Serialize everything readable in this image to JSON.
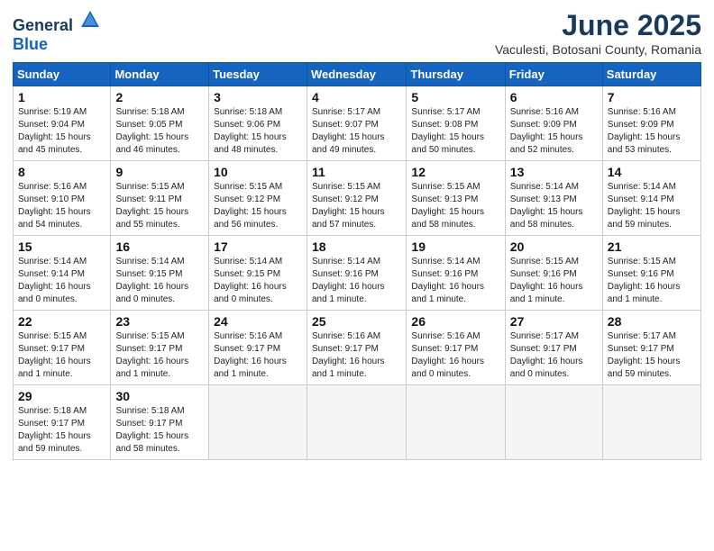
{
  "header": {
    "logo_general": "General",
    "logo_blue": "Blue",
    "month_title": "June 2025",
    "location": "Vaculesti, Botosani County, Romania"
  },
  "columns": [
    "Sunday",
    "Monday",
    "Tuesday",
    "Wednesday",
    "Thursday",
    "Friday",
    "Saturday"
  ],
  "weeks": [
    [
      {
        "day": "1",
        "info": "Sunrise: 5:19 AM\nSunset: 9:04 PM\nDaylight: 15 hours\nand 45 minutes."
      },
      {
        "day": "2",
        "info": "Sunrise: 5:18 AM\nSunset: 9:05 PM\nDaylight: 15 hours\nand 46 minutes."
      },
      {
        "day": "3",
        "info": "Sunrise: 5:18 AM\nSunset: 9:06 PM\nDaylight: 15 hours\nand 48 minutes."
      },
      {
        "day": "4",
        "info": "Sunrise: 5:17 AM\nSunset: 9:07 PM\nDaylight: 15 hours\nand 49 minutes."
      },
      {
        "day": "5",
        "info": "Sunrise: 5:17 AM\nSunset: 9:08 PM\nDaylight: 15 hours\nand 50 minutes."
      },
      {
        "day": "6",
        "info": "Sunrise: 5:16 AM\nSunset: 9:09 PM\nDaylight: 15 hours\nand 52 minutes."
      },
      {
        "day": "7",
        "info": "Sunrise: 5:16 AM\nSunset: 9:09 PM\nDaylight: 15 hours\nand 53 minutes."
      }
    ],
    [
      {
        "day": "8",
        "info": "Sunrise: 5:16 AM\nSunset: 9:10 PM\nDaylight: 15 hours\nand 54 minutes."
      },
      {
        "day": "9",
        "info": "Sunrise: 5:15 AM\nSunset: 9:11 PM\nDaylight: 15 hours\nand 55 minutes."
      },
      {
        "day": "10",
        "info": "Sunrise: 5:15 AM\nSunset: 9:12 PM\nDaylight: 15 hours\nand 56 minutes."
      },
      {
        "day": "11",
        "info": "Sunrise: 5:15 AM\nSunset: 9:12 PM\nDaylight: 15 hours\nand 57 minutes."
      },
      {
        "day": "12",
        "info": "Sunrise: 5:15 AM\nSunset: 9:13 PM\nDaylight: 15 hours\nand 58 minutes."
      },
      {
        "day": "13",
        "info": "Sunrise: 5:14 AM\nSunset: 9:13 PM\nDaylight: 15 hours\nand 58 minutes."
      },
      {
        "day": "14",
        "info": "Sunrise: 5:14 AM\nSunset: 9:14 PM\nDaylight: 15 hours\nand 59 minutes."
      }
    ],
    [
      {
        "day": "15",
        "info": "Sunrise: 5:14 AM\nSunset: 9:14 PM\nDaylight: 16 hours\nand 0 minutes."
      },
      {
        "day": "16",
        "info": "Sunrise: 5:14 AM\nSunset: 9:15 PM\nDaylight: 16 hours\nand 0 minutes."
      },
      {
        "day": "17",
        "info": "Sunrise: 5:14 AM\nSunset: 9:15 PM\nDaylight: 16 hours\nand 0 minutes."
      },
      {
        "day": "18",
        "info": "Sunrise: 5:14 AM\nSunset: 9:16 PM\nDaylight: 16 hours\nand 1 minute."
      },
      {
        "day": "19",
        "info": "Sunrise: 5:14 AM\nSunset: 9:16 PM\nDaylight: 16 hours\nand 1 minute."
      },
      {
        "day": "20",
        "info": "Sunrise: 5:15 AM\nSunset: 9:16 PM\nDaylight: 16 hours\nand 1 minute."
      },
      {
        "day": "21",
        "info": "Sunrise: 5:15 AM\nSunset: 9:16 PM\nDaylight: 16 hours\nand 1 minute."
      }
    ],
    [
      {
        "day": "22",
        "info": "Sunrise: 5:15 AM\nSunset: 9:17 PM\nDaylight: 16 hours\nand 1 minute."
      },
      {
        "day": "23",
        "info": "Sunrise: 5:15 AM\nSunset: 9:17 PM\nDaylight: 16 hours\nand 1 minute."
      },
      {
        "day": "24",
        "info": "Sunrise: 5:16 AM\nSunset: 9:17 PM\nDaylight: 16 hours\nand 1 minute."
      },
      {
        "day": "25",
        "info": "Sunrise: 5:16 AM\nSunset: 9:17 PM\nDaylight: 16 hours\nand 1 minute."
      },
      {
        "day": "26",
        "info": "Sunrise: 5:16 AM\nSunset: 9:17 PM\nDaylight: 16 hours\nand 0 minutes."
      },
      {
        "day": "27",
        "info": "Sunrise: 5:17 AM\nSunset: 9:17 PM\nDaylight: 16 hours\nand 0 minutes."
      },
      {
        "day": "28",
        "info": "Sunrise: 5:17 AM\nSunset: 9:17 PM\nDaylight: 15 hours\nand 59 minutes."
      }
    ],
    [
      {
        "day": "29",
        "info": "Sunrise: 5:18 AM\nSunset: 9:17 PM\nDaylight: 15 hours\nand 59 minutes."
      },
      {
        "day": "30",
        "info": "Sunrise: 5:18 AM\nSunset: 9:17 PM\nDaylight: 15 hours\nand 58 minutes."
      },
      {
        "day": "",
        "info": ""
      },
      {
        "day": "",
        "info": ""
      },
      {
        "day": "",
        "info": ""
      },
      {
        "day": "",
        "info": ""
      },
      {
        "day": "",
        "info": ""
      }
    ]
  ]
}
